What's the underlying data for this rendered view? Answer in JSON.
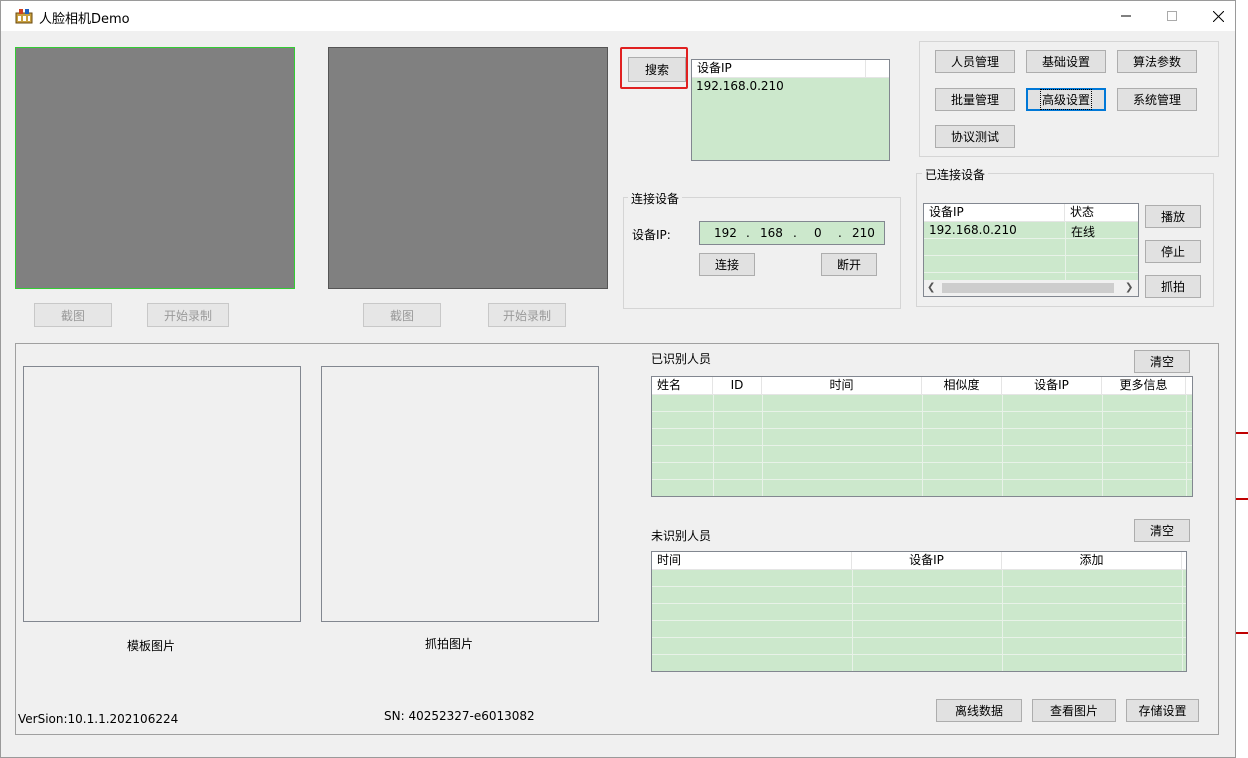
{
  "window": {
    "title": "人脸相机Demo"
  },
  "preview": {
    "left": {
      "snapshot_label": "截图",
      "record_label": "开始录制"
    },
    "right": {
      "snapshot_label": "截图",
      "record_label": "开始录制"
    }
  },
  "search": {
    "button_label": "搜索",
    "list_header": "设备IP",
    "results": [
      "192.168.0.210"
    ]
  },
  "connect_group": {
    "title": "连接设备",
    "ip_label": "设备IP:",
    "ip_octets": [
      "192",
      "168",
      "0",
      "210"
    ],
    "connect_label": "连接",
    "disconnect_label": "断开"
  },
  "menu_buttons": {
    "row1": [
      "人员管理",
      "基础设置",
      "算法参数"
    ],
    "row2": [
      "批量管理",
      "高级设置",
      "系统管理"
    ],
    "row3": [
      "协议测试"
    ]
  },
  "connected": {
    "title": "已连接设备",
    "columns": [
      "设备IP",
      "状态"
    ],
    "rows": [
      {
        "ip": "192.168.0.210",
        "status": "在线"
      }
    ],
    "play_label": "播放",
    "stop_label": "停止",
    "capture_label": "抓拍"
  },
  "recognized": {
    "title": "已识别人员",
    "clear_label": "清空",
    "columns": [
      "姓名",
      "ID",
      "时间",
      "相似度",
      "设备IP",
      "更多信息"
    ]
  },
  "unrecognized": {
    "title": "未识别人员",
    "clear_label": "清空",
    "columns": [
      "时间",
      "设备IP",
      "添加"
    ]
  },
  "pictures": {
    "template_label": "模板图片",
    "capture_label": "抓拍图片"
  },
  "footer": {
    "version": "VerSion:10.1.1.202106224",
    "sn": "SN: 40252327-e6013082",
    "offline_label": "离线数据",
    "view_label": "查看图片",
    "storage_label": "存储设置"
  },
  "colors": {
    "list_bg": "#cce8cc",
    "highlight": "#e02020",
    "active_video_border": "#33cc33"
  }
}
